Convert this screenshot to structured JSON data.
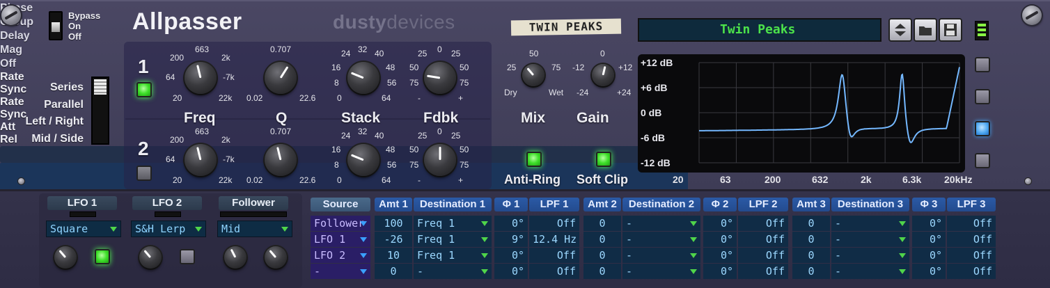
{
  "device": {
    "title": "Allpasser",
    "brand_a": "dusty",
    "brand_b": "devices"
  },
  "power": {
    "options": [
      "Bypass",
      "On",
      "Off"
    ]
  },
  "routing": {
    "options": [
      "Series",
      "Parallel",
      "Left / Right",
      "Mid / Side"
    ]
  },
  "filters": {
    "row1_label": "1",
    "row2_label": "2",
    "freq": {
      "label": "Freq",
      "ticks": [
        "663",
        "200",
        "2k",
        "64",
        "-7k",
        "20",
        "22k"
      ]
    },
    "q": {
      "label": "Q",
      "ticks": [
        "0.707",
        "0.02",
        "22.6"
      ]
    },
    "stack": {
      "label": "Stack",
      "ticks": [
        "32",
        "24",
        "40",
        "16",
        "48",
        "8",
        "56",
        "0",
        "64"
      ]
    },
    "fdbk": {
      "label": "Fdbk",
      "ticks": [
        "0",
        "25",
        "25",
        "50",
        "50",
        "75",
        "75",
        "-",
        "+"
      ]
    },
    "row1": {
      "freq": 0.45,
      "q": 0.62,
      "stack": 0.25,
      "fdbk": 0.2,
      "enabled": true
    },
    "row2": {
      "freq": 0.45,
      "q": 0.45,
      "stack": 0.25,
      "fdbk": 0.5,
      "enabled": false
    }
  },
  "mix": {
    "label": "Mix",
    "ticks": [
      "50",
      "25",
      "75",
      "Dry",
      "Wet"
    ],
    "value": 0.35
  },
  "gain": {
    "label": "Gain",
    "ticks": [
      "0",
      "-12",
      "+12",
      "-24",
      "+24"
    ],
    "value": 0.55
  },
  "anti_ring": {
    "label": "Anti-Ring",
    "on": true
  },
  "soft_clip": {
    "label": "Soft Clip",
    "on": true
  },
  "patch": {
    "tape_label": "TWIN PEAKS",
    "name": "Twin Peaks"
  },
  "display": {
    "y_labels": [
      "+12 dB",
      "+6 dB",
      "0 dB",
      "-6 dB",
      "-12 dB"
    ],
    "x_labels": [
      "20",
      "63",
      "200",
      "632",
      "2k",
      "6.3k",
      "20kHz"
    ]
  },
  "view_modes": [
    {
      "label": "Phase",
      "active": false
    },
    {
      "label": "Group\nDelay",
      "active": false
    },
    {
      "label": "Mag",
      "active": true
    },
    {
      "label": "Off",
      "active": false
    }
  ],
  "modulators": [
    {
      "title": "LFO 1",
      "shape": "Square",
      "knob_label": "Rate",
      "btn_label": "Sync",
      "sync": true
    },
    {
      "title": "LFO 2",
      "shape": "S&H Lerp",
      "knob_label": "Rate",
      "btn_label": "Sync",
      "sync": false
    },
    {
      "title": "Follower",
      "shape": "Mid",
      "knob1_label": "Att",
      "knob2_label": "Rel"
    }
  ],
  "matrix": {
    "headers": [
      "Source",
      "Amt 1",
      "Destination 1",
      "Φ 1",
      "LPF 1",
      "Amt 2",
      "Destination 2",
      "Φ 2",
      "LPF 2",
      "Amt 3",
      "Destination 3",
      "Φ 3",
      "LPF 3"
    ],
    "rows": [
      [
        "Follower",
        "100",
        "Freq 1",
        "0°",
        "Off",
        "0",
        "-",
        "0°",
        "Off",
        "0",
        "-",
        "0°",
        "Off"
      ],
      [
        "LFO 1",
        "-26",
        "Freq 1",
        "9°",
        "12.4 Hz",
        "0",
        "-",
        "0°",
        "Off",
        "0",
        "-",
        "0°",
        "Off"
      ],
      [
        "LFO 2",
        "10",
        "Freq 1",
        "0°",
        "Off",
        "0",
        "-",
        "0°",
        "Off",
        "0",
        "-",
        "0°",
        "Off"
      ],
      [
        "-",
        "0",
        "-",
        "0°",
        "Off",
        "0",
        "-",
        "0°",
        "Off",
        "0",
        "-",
        "0°",
        "Off"
      ]
    ]
  }
}
